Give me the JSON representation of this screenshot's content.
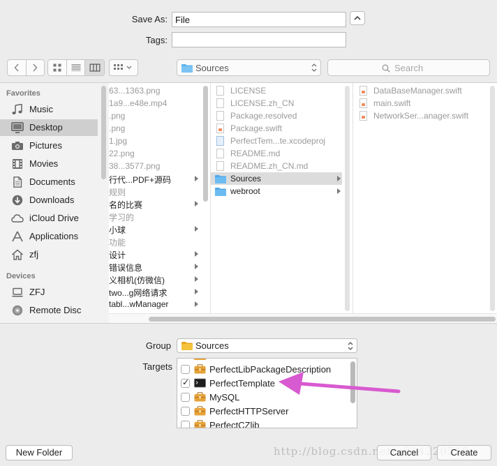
{
  "form": {
    "save_as_label": "Save As:",
    "save_as_value": "File",
    "tags_label": "Tags:",
    "tags_value": ""
  },
  "toolbar": {
    "path_popup": "Sources",
    "search_placeholder": "Search"
  },
  "sidebar": {
    "favorites_header": "Favorites",
    "favorites": [
      {
        "label": "Music",
        "icon": "music-note-icon"
      },
      {
        "label": "Desktop",
        "icon": "desktop-icon",
        "selected": true
      },
      {
        "label": "Pictures",
        "icon": "camera-icon"
      },
      {
        "label": "Movies",
        "icon": "film-icon"
      },
      {
        "label": "Documents",
        "icon": "document-icon"
      },
      {
        "label": "Downloads",
        "icon": "download-icon"
      },
      {
        "label": "iCloud Drive",
        "icon": "cloud-icon"
      },
      {
        "label": "Applications",
        "icon": "applications-icon"
      },
      {
        "label": "zfj",
        "icon": "home-icon"
      }
    ],
    "devices_header": "Devices",
    "devices": [
      {
        "label": "ZFJ",
        "icon": "laptop-icon"
      },
      {
        "label": "Remote Disc",
        "icon": "disc-icon"
      }
    ]
  },
  "columns": {
    "col1": [
      {
        "name": "63...1363.png",
        "dim": true
      },
      {
        "name": "1a9...e48e.mp4",
        "dim": true
      },
      {
        "name": ".png",
        "dim": true
      },
      {
        "name": ".png",
        "dim": true
      },
      {
        "name": "1.jpg",
        "dim": true
      },
      {
        "name": "22.png",
        "dim": true
      },
      {
        "name": "38...3577.png",
        "dim": true
      },
      {
        "name": "行代...PDF+源码",
        "dim": false,
        "arrow": true
      },
      {
        "name": "规则",
        "dim": true
      },
      {
        "name": "名的比赛",
        "dim": false,
        "arrow": true
      },
      {
        "name": "学习的",
        "dim": true
      },
      {
        "name": "小球",
        "dim": false,
        "arrow": true
      },
      {
        "name": "功能",
        "dim": true
      },
      {
        "name": "设计",
        "dim": false,
        "arrow": true
      },
      {
        "name": "错误信息",
        "dim": false,
        "arrow": true
      },
      {
        "name": "义相机(仿微信)",
        "dim": false,
        "arrow": true
      },
      {
        "name": "two...g网络请求",
        "dim": false,
        "arrow": true
      },
      {
        "name": "tabl...wManager",
        "dim": false,
        "arrow": true
      }
    ],
    "col2": [
      {
        "name": "LICENSE",
        "dim": true,
        "kind": "doc"
      },
      {
        "name": "LICENSE.zh_CN",
        "dim": true,
        "kind": "doc"
      },
      {
        "name": "Package.resolved",
        "dim": true,
        "kind": "doc"
      },
      {
        "name": "Package.swift",
        "dim": true,
        "kind": "swift"
      },
      {
        "name": "PerfectTem...te.xcodeproj",
        "dim": true,
        "kind": "xcode"
      },
      {
        "name": "README.md",
        "dim": true,
        "kind": "doc"
      },
      {
        "name": "README.zh_CN.md",
        "dim": true,
        "kind": "doc"
      },
      {
        "name": "Sources",
        "dim": false,
        "kind": "folder",
        "selected": true,
        "arrow": true
      },
      {
        "name": "webroot",
        "dim": false,
        "kind": "folder",
        "arrow": true
      }
    ],
    "col3": [
      {
        "name": "DataBaseManager.swift",
        "dim": true
      },
      {
        "name": "main.swift",
        "dim": true
      },
      {
        "name": "NetworkSer...anager.swift",
        "dim": true
      }
    ]
  },
  "bottom": {
    "group_label": "Group",
    "group_value": "Sources",
    "targets_label": "Targets",
    "targets": [
      {
        "name": "PerfectLibPackageDescription",
        "checked": false,
        "icon": "toolbox-icon"
      },
      {
        "name": "PerfectTemplate",
        "checked": true,
        "icon": "terminal-icon"
      },
      {
        "name": "MySQL",
        "checked": false,
        "icon": "toolbox-icon"
      },
      {
        "name": "PerfectHTTPServer",
        "checked": false,
        "icon": "toolbox-icon"
      },
      {
        "name": "PerfectCZlib",
        "checked": false,
        "icon": "toolbox-icon"
      }
    ]
  },
  "buttons": {
    "new_folder": "New Folder",
    "cancel": "Cancel",
    "create": "Create"
  },
  "watermark": "http://blog.csdn.net/u014220518",
  "colors": {
    "annotation_arrow": "#d85ad0",
    "folder_blue": "#5fb3ee",
    "folder_yellow": "#f5c33b",
    "selection_gray": "#dcdcdc"
  }
}
